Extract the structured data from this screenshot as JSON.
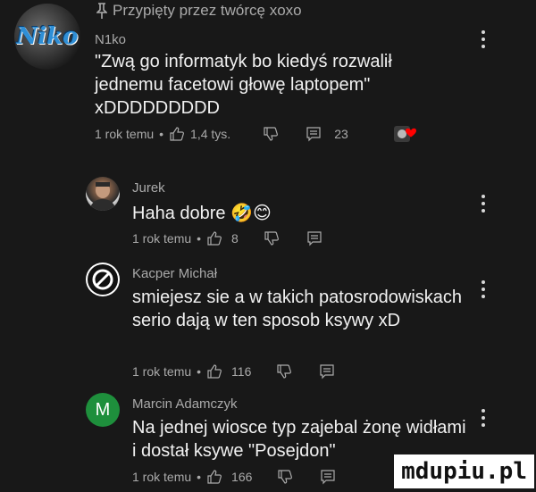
{
  "pinned_comment": {
    "pinned_label": "Przypięty przez twórcę xoxo",
    "author": "N1ko",
    "avatar_text": "Niko",
    "text": "\"Zwą go informatyk bo kiedyś rozwalił jednemu facetowi głowę laptopem\"\nxDDDDDDDDD",
    "time": "1 rok temu",
    "likes": "1,4 tys.",
    "replies_count": "23"
  },
  "comments": [
    {
      "author": "Jurek",
      "text": "Haha dobre 🤣😊",
      "time": "1 rok temu",
      "likes": "8"
    },
    {
      "author": "Kacper Michał",
      "text": "smiejesz sie a w takich patosrodowiskach serio dają w ten sposob ksywy xD",
      "time": "1 rok temu",
      "likes": "116"
    },
    {
      "author": "Marcin Adamczyk",
      "avatar_letter": "M",
      "text": "Na jednej wiosce typ zajebal żonę widłami i dostał ksywe \"Posejdon\"",
      "time": "1 rok temu",
      "likes": "166"
    }
  ],
  "colors": {
    "background": "#181818",
    "text_primary": "#f1f1f1",
    "text_secondary": "#aaaaaa",
    "avatar_marcin": "#1e8f3c"
  },
  "watermark": "mdupiu.pl"
}
